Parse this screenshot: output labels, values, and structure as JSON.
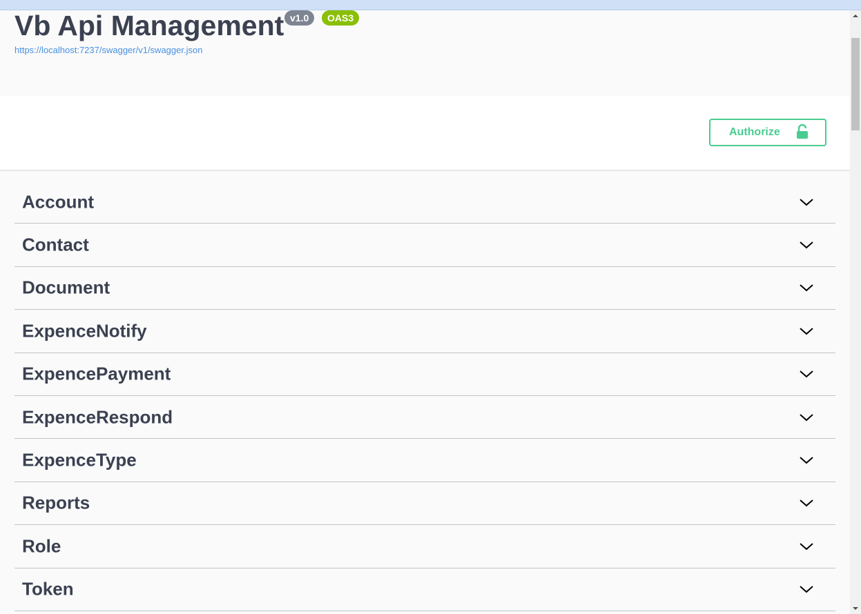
{
  "header": {
    "title": "Vb Api Management",
    "version_badge": "v1.0",
    "oas_badge": "OAS3",
    "spec_url": "https://localhost:7237/swagger/v1/swagger.json"
  },
  "scheme": {
    "authorize_label": "Authorize",
    "authorize_icon": "unlocked-padlock-icon"
  },
  "tags": [
    {
      "name": "Account"
    },
    {
      "name": "Contact"
    },
    {
      "name": "Document"
    },
    {
      "name": "ExpenceNotify"
    },
    {
      "name": "ExpencePayment"
    },
    {
      "name": "ExpenceRespond"
    },
    {
      "name": "ExpenceType"
    },
    {
      "name": "Reports"
    },
    {
      "name": "Role"
    },
    {
      "name": "Token"
    }
  ],
  "colors": {
    "accent_green": "#49cc90",
    "text": "#3b4151",
    "link": "#4990e2",
    "badge_version": "#7d8492",
    "badge_oas": "#89bf04"
  }
}
